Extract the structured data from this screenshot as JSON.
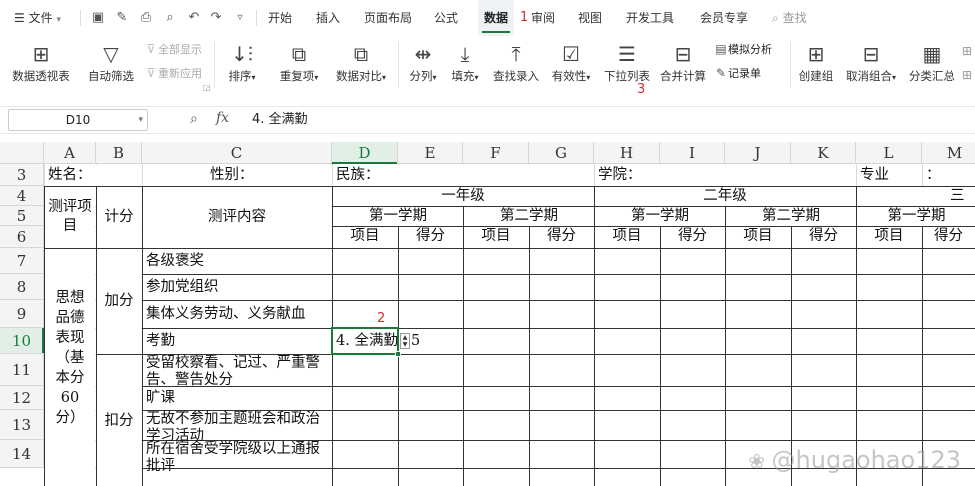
{
  "menubar": {
    "file_label": "文件",
    "tabs": [
      {
        "label": "开始"
      },
      {
        "label": "插入"
      },
      {
        "label": "页面布局"
      },
      {
        "label": "公式"
      },
      {
        "label": "数据"
      },
      {
        "label": "审阅"
      },
      {
        "label": "视图"
      },
      {
        "label": "开发工具"
      },
      {
        "label": "会员专享"
      }
    ],
    "search_label": "查找",
    "marker_1": "1"
  },
  "ribbon": {
    "pivot_table": "数据透视表",
    "auto_filter": "自动筛选",
    "show_all": "全部显示",
    "reapply": "重新应用",
    "sort": "排序",
    "duplicates": "重复项",
    "compare": "数据对比",
    "split_column": "分列",
    "fill": "填充",
    "find_entry": "查找录入",
    "validity": "有效性",
    "dropdown_list": "下拉列表",
    "consolidate": "合并计算",
    "what_if": "模拟分析",
    "record_form": "记录单",
    "create_group": "创建组",
    "ungroup": "取消组合",
    "subtotal": "分类汇总",
    "marker_3": "3"
  },
  "formula_bar": {
    "cell_ref": "D10",
    "fx": "fx",
    "value": "4. 全满勤"
  },
  "sheet": {
    "columns": [
      "A",
      "B",
      "C",
      "D",
      "E",
      "F",
      "G",
      "H",
      "I",
      "J",
      "K",
      "L",
      "M"
    ],
    "rows": [
      "3",
      "4",
      "5",
      "6",
      "7",
      "8",
      "9",
      "10",
      "11",
      "12",
      "13",
      "14"
    ],
    "cells": {
      "name": "姓名：",
      "gender": "性别：",
      "ethnicity": "民族：",
      "college": "学院：",
      "major": "专业",
      "colon_m3": "：",
      "eval_item": "测评项目",
      "score_calc": "计分",
      "eval_content": "测评内容",
      "grade1": "一年级",
      "grade2": "二年级",
      "grade3": "三",
      "sem1_a": "第一学期",
      "sem2_a": "第二学期",
      "sem1_b": "第一学期",
      "sem2_b": "第二学期",
      "sem1_c": "第一学期",
      "item": "项目",
      "score": "得分",
      "moral": "思想品德表现（基本分60分）",
      "plus": "加分",
      "minus": "扣分",
      "r7": "各级褒奖",
      "r8": "参加党组织",
      "r9": "集体义务劳动、义务献血",
      "r10": "考勤",
      "d10": "4. 全满勤",
      "e10": "5",
      "r11": "受留校察看、记过、严重警告、警告处分",
      "r12": "旷课",
      "r13": "无故不参加主题班会和政治学习活动",
      "r14": "所在宿舍受学院级以上通报批评"
    },
    "marker_2": "2",
    "watermark": "@hugaohao123"
  }
}
